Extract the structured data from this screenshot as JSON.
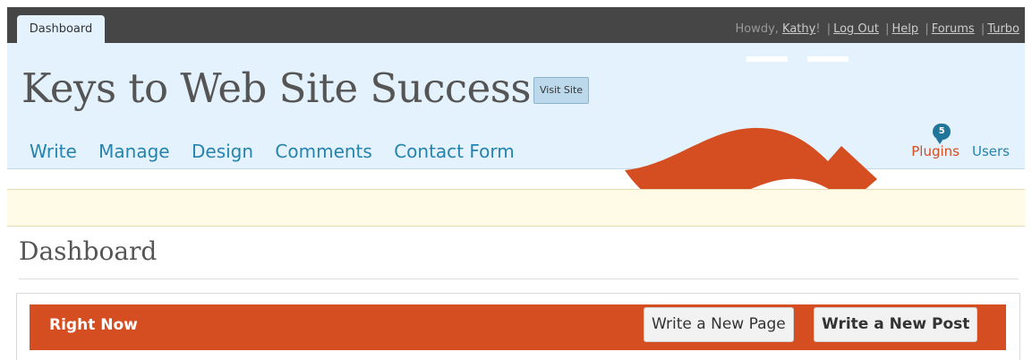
{
  "topbar": {
    "dashboard_tab": "Dashboard",
    "howdy_prefix": "Howdy, ",
    "user_name": "Kathy",
    "howdy_suffix": "!",
    "links": [
      "Log Out",
      "Help",
      "Forums",
      "Turbo"
    ]
  },
  "header": {
    "site_title": "Keys to Web Site Success",
    "visit_site": "Visit Site",
    "main_nav": [
      "Write",
      "Manage",
      "Design",
      "Comments",
      "Contact Form"
    ],
    "sub_nav": {
      "plugins": "Plugins",
      "plugins_badge": "5",
      "users": "Users"
    }
  },
  "page": {
    "title": "Dashboard",
    "right_now": {
      "title": "Right Now",
      "write_page": "Write a New Page",
      "write_post": "Write a New Post"
    }
  },
  "colors": {
    "accent": "#d54e21",
    "link": "#2583ad",
    "header_bg": "#e4f2fd",
    "topbar": "#464646"
  }
}
